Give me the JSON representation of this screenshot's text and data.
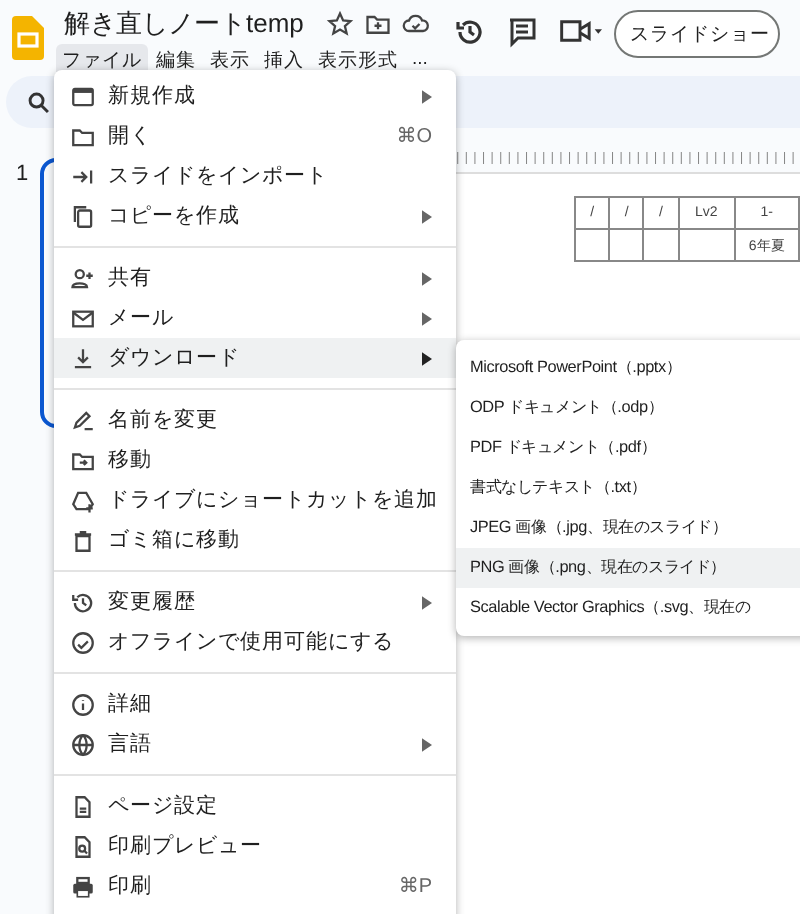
{
  "document": {
    "title": "解き直しノートtemp"
  },
  "menubar": [
    {
      "label": "ファイル",
      "selected": true
    },
    {
      "label": "編集",
      "selected": false
    },
    {
      "label": "表示",
      "selected": false
    },
    {
      "label": "挿入",
      "selected": false
    },
    {
      "label": "表示形式",
      "selected": false
    },
    {
      "label": "...",
      "selected": false
    }
  ],
  "slideshow_button": "スライドショー",
  "filmstrip": {
    "slide_number": "1",
    "selected": true
  },
  "slide_table": {
    "rows": [
      [
        "/",
        "/",
        "/",
        "Lv2",
        "1-"
      ],
      [
        "",
        "",
        "",
        "",
        "6年夏"
      ]
    ]
  },
  "file_menu": {
    "sections": [
      [
        {
          "label": "新規作成",
          "submenu": true,
          "highlighted": false
        },
        {
          "label": "開く",
          "shortcut": "⌘O",
          "submenu": false,
          "highlighted": false
        },
        {
          "label": "スライドをインポート",
          "submenu": false,
          "highlighted": false
        },
        {
          "label": "コピーを作成",
          "submenu": true,
          "highlighted": false
        }
      ],
      [
        {
          "label": "共有",
          "submenu": true,
          "highlighted": false
        },
        {
          "label": "メール",
          "submenu": true,
          "highlighted": false
        },
        {
          "label": "ダウンロード",
          "submenu": true,
          "highlighted": true
        }
      ],
      [
        {
          "label": "名前を変更",
          "submenu": false,
          "highlighted": false
        },
        {
          "label": "移動",
          "submenu": false,
          "highlighted": false
        },
        {
          "label": "ドライブにショートカットを追加",
          "submenu": false,
          "highlighted": false
        },
        {
          "label": "ゴミ箱に移動",
          "submenu": false,
          "highlighted": false
        }
      ],
      [
        {
          "label": "変更履歴",
          "submenu": true,
          "highlighted": false
        },
        {
          "label": "オフラインで使用可能にする",
          "submenu": false,
          "highlighted": false
        }
      ],
      [
        {
          "label": "詳細",
          "submenu": false,
          "highlighted": false
        },
        {
          "label": "言語",
          "submenu": true,
          "highlighted": false
        }
      ],
      [
        {
          "label": "ページ設定",
          "submenu": false,
          "highlighted": false
        },
        {
          "label": "印刷プレビュー",
          "submenu": false,
          "highlighted": false
        },
        {
          "label": "印刷",
          "shortcut": "⌘P",
          "submenu": false,
          "highlighted": false
        }
      ]
    ]
  },
  "download_menu": [
    {
      "label": "Microsoft PowerPoint（.pptx）",
      "selected": false
    },
    {
      "label": "ODP ドキュメント（.odp）",
      "selected": false
    },
    {
      "label": "PDF ドキュメント（.pdf）",
      "selected": false
    },
    {
      "label": "書式なしテキスト（.txt）",
      "selected": false
    },
    {
      "label": "JPEG 画像（.jpg、現在のスライド）",
      "selected": false
    },
    {
      "label": "PNG 画像（.png、現在のスライド）",
      "selected": true
    },
    {
      "label": "Scalable Vector Graphics（.svg、現在の",
      "selected": false
    }
  ]
}
